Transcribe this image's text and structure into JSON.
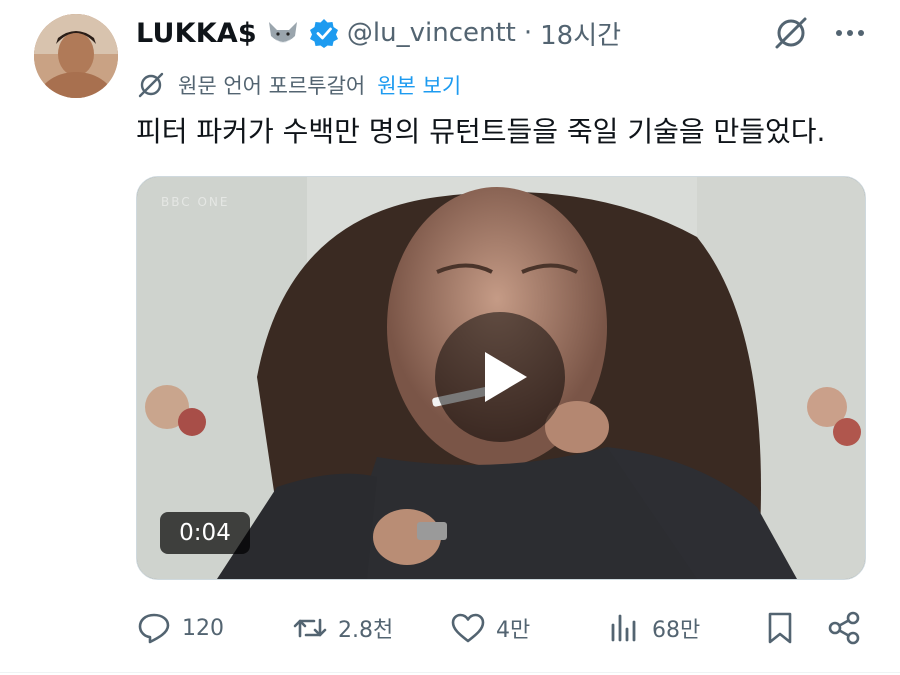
{
  "tweet": {
    "display_name": "LUKKA$",
    "handle": "@lu_vincentt",
    "separator": "·",
    "time": "18시간",
    "translate_text": "원문 언어 포르투갈어",
    "translate_link": "원본 보기",
    "text": "피터 파커가 수백만 명의 뮤턴트들을 죽일 기술을 만들었다.",
    "video": {
      "duration": "0:04",
      "watermark": "BBC ONE"
    },
    "actions": {
      "replies": "120",
      "reposts": "2.8천",
      "likes": "4만",
      "views": "68만"
    }
  },
  "colors": {
    "accent": "#1d9bf0",
    "text_primary": "#0f1419",
    "text_secondary": "#536471"
  },
  "icons": [
    "grok-icon",
    "more-icon",
    "verified-badge-icon",
    "wolf-emoji-icon",
    "translate-icon",
    "play-icon",
    "reply-icon",
    "repost-icon",
    "like-icon",
    "views-icon",
    "bookmark-icon",
    "share-icon"
  ]
}
